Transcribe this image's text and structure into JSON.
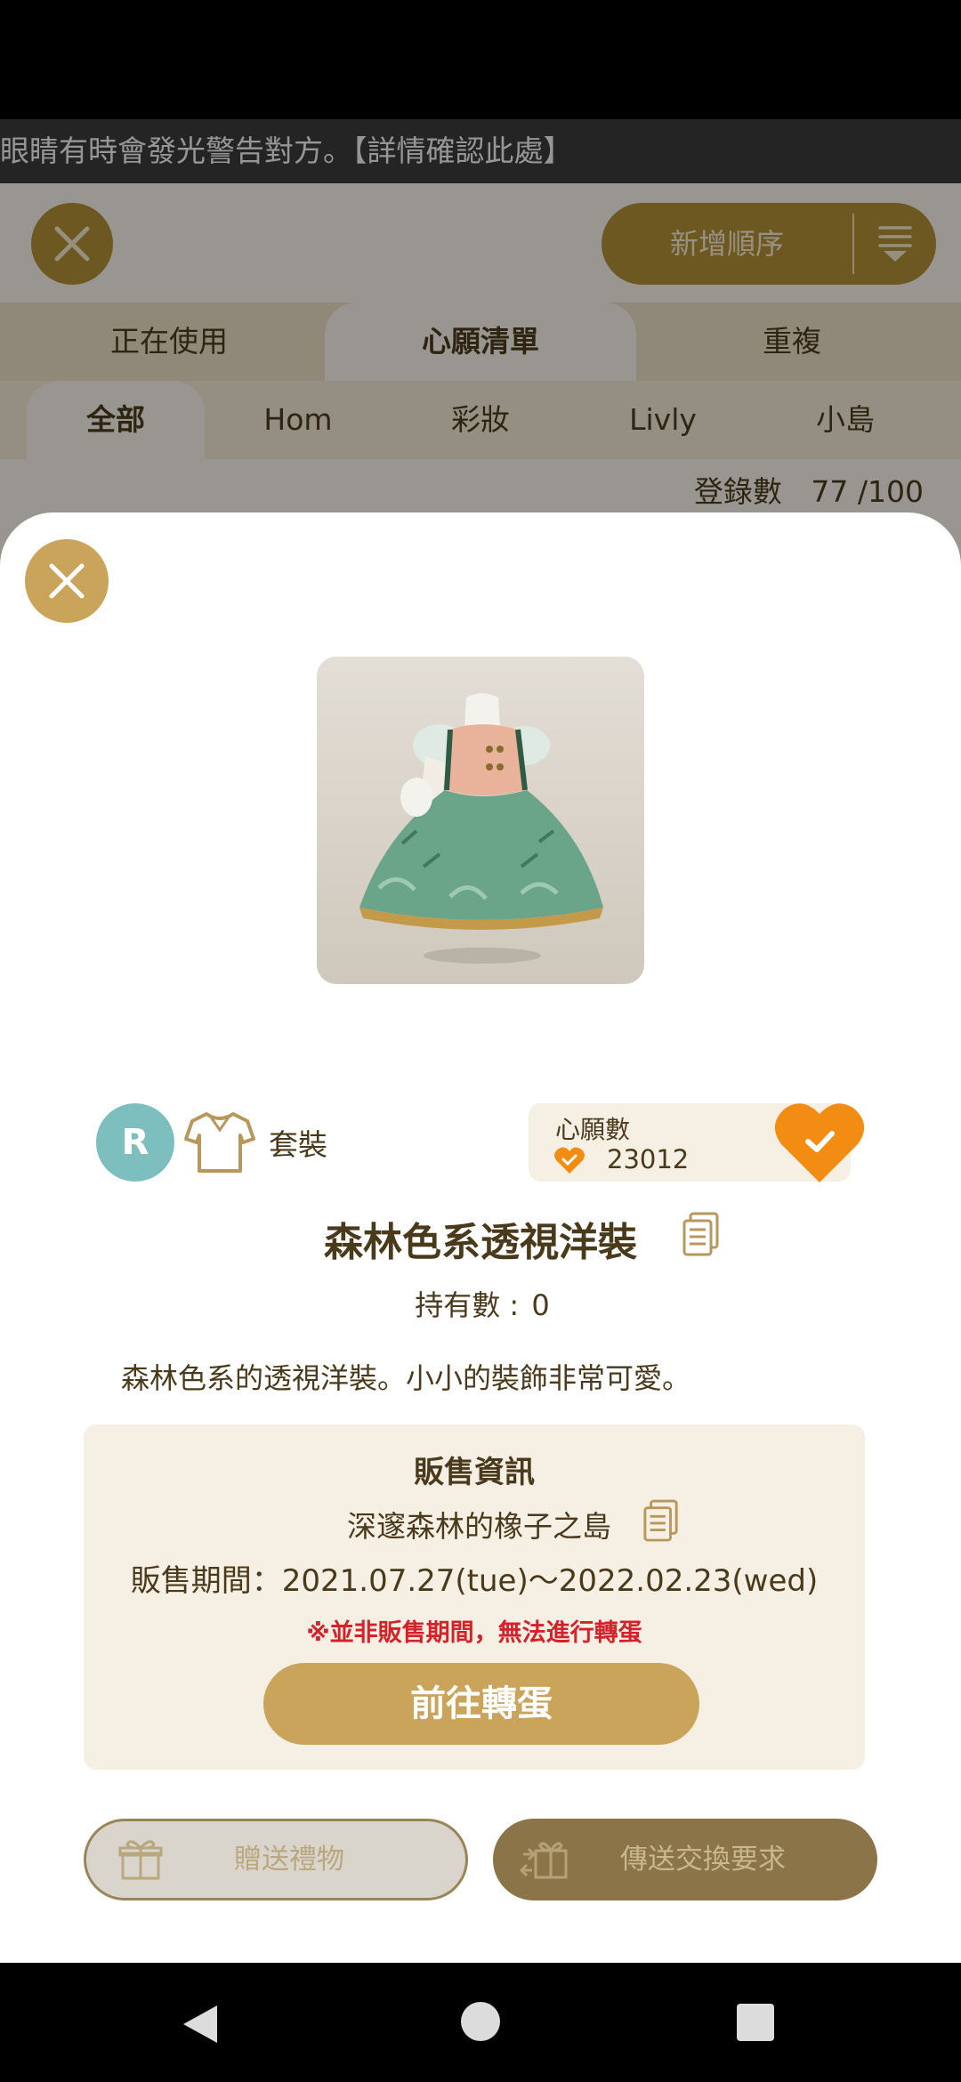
{
  "background": {
    "ticker_text": "眼睛有時會發光警告對方。【詳情確認此處】",
    "sort_button_label": "新增順序",
    "main_tabs": [
      {
        "label": "正在使用",
        "active": false
      },
      {
        "label": "心願清單",
        "active": true
      },
      {
        "label": "重複",
        "active": false
      }
    ],
    "sub_tabs": [
      {
        "label": "全部",
        "active": true
      },
      {
        "label": "Hom",
        "active": false
      },
      {
        "label": "彩妝",
        "active": false
      },
      {
        "label": "Livly",
        "active": false
      },
      {
        "label": "小島",
        "active": false
      }
    ],
    "registered_label": "登錄數",
    "registered_count": "77 /100"
  },
  "item": {
    "rarity": "R",
    "category_icon": "shirt-icon",
    "category": "套裝",
    "wish_title": "心願數",
    "wish_count": "23012",
    "wish_added": true,
    "name": "森林色系透視洋裝",
    "owned_label": "持有數 :",
    "owned_value": "0",
    "description": "森林色系的透視洋裝。小小的裝飾非常可愛。"
  },
  "sale": {
    "title": "販售資訊",
    "shop_name": "深邃森林的橡子之島",
    "period": "販售期間：2021.07.27(tue)～2022.02.23(wed)",
    "warning": "※並非販售期間，無法進行轉蛋",
    "gacha_button": "前往轉蛋"
  },
  "actions": {
    "gift_label": "贈送禮物",
    "trade_label": "傳送交換要求"
  },
  "colors": {
    "accent_gold": "#c9a45a",
    "heart_orange": "#f28c13",
    "warning_red": "#d4222a",
    "rarity_teal": "#7dbfbf"
  }
}
